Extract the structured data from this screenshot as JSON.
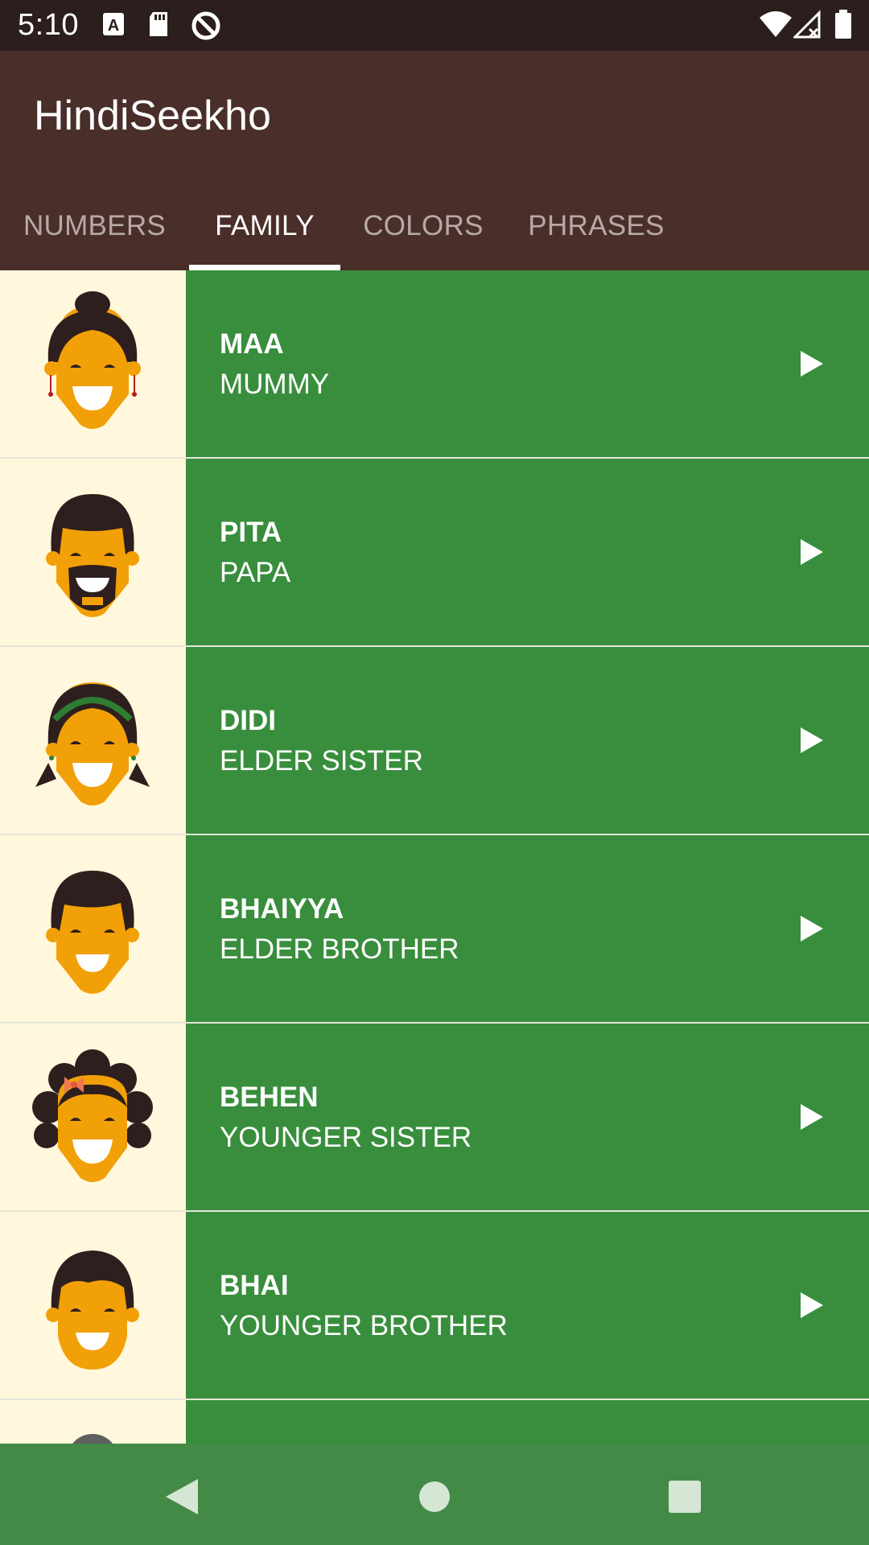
{
  "status_bar": {
    "time": "5:10",
    "icons_left": [
      "a-icon",
      "sd-card-icon",
      "no-sync-icon"
    ],
    "icons_right": [
      "wifi-icon",
      "cell-signal-icon",
      "battery-icon"
    ]
  },
  "app": {
    "title": "HindiSeekho"
  },
  "tabs": [
    {
      "label": "NUMBERS",
      "active": false
    },
    {
      "label": "FAMILY",
      "active": true
    },
    {
      "label": "COLORS",
      "active": false
    },
    {
      "label": "PHRASES",
      "active": false
    }
  ],
  "items": [
    {
      "hindi": "MAA",
      "english": "MUMMY",
      "avatar": "mother-avatar-icon"
    },
    {
      "hindi": "PITA",
      "english": "PAPA",
      "avatar": "father-avatar-icon"
    },
    {
      "hindi": "DIDI",
      "english": "ELDER SISTER",
      "avatar": "elder-sister-avatar-icon"
    },
    {
      "hindi": "BHAIYYA",
      "english": "ELDER BROTHER",
      "avatar": "elder-brother-avatar-icon"
    },
    {
      "hindi": "BEHEN",
      "english": "YOUNGER SISTER",
      "avatar": "younger-sister-avatar-icon"
    },
    {
      "hindi": "BHAI",
      "english": "YOUNGER BROTHER",
      "avatar": "younger-brother-avatar-icon"
    }
  ],
  "colors": {
    "status_bar": "#2B1E1C",
    "app_bar": "#4A2E2A",
    "item_green": "#388E3C",
    "avatar_bg": "#FFF8DC",
    "nav_bar": "#438A47"
  }
}
